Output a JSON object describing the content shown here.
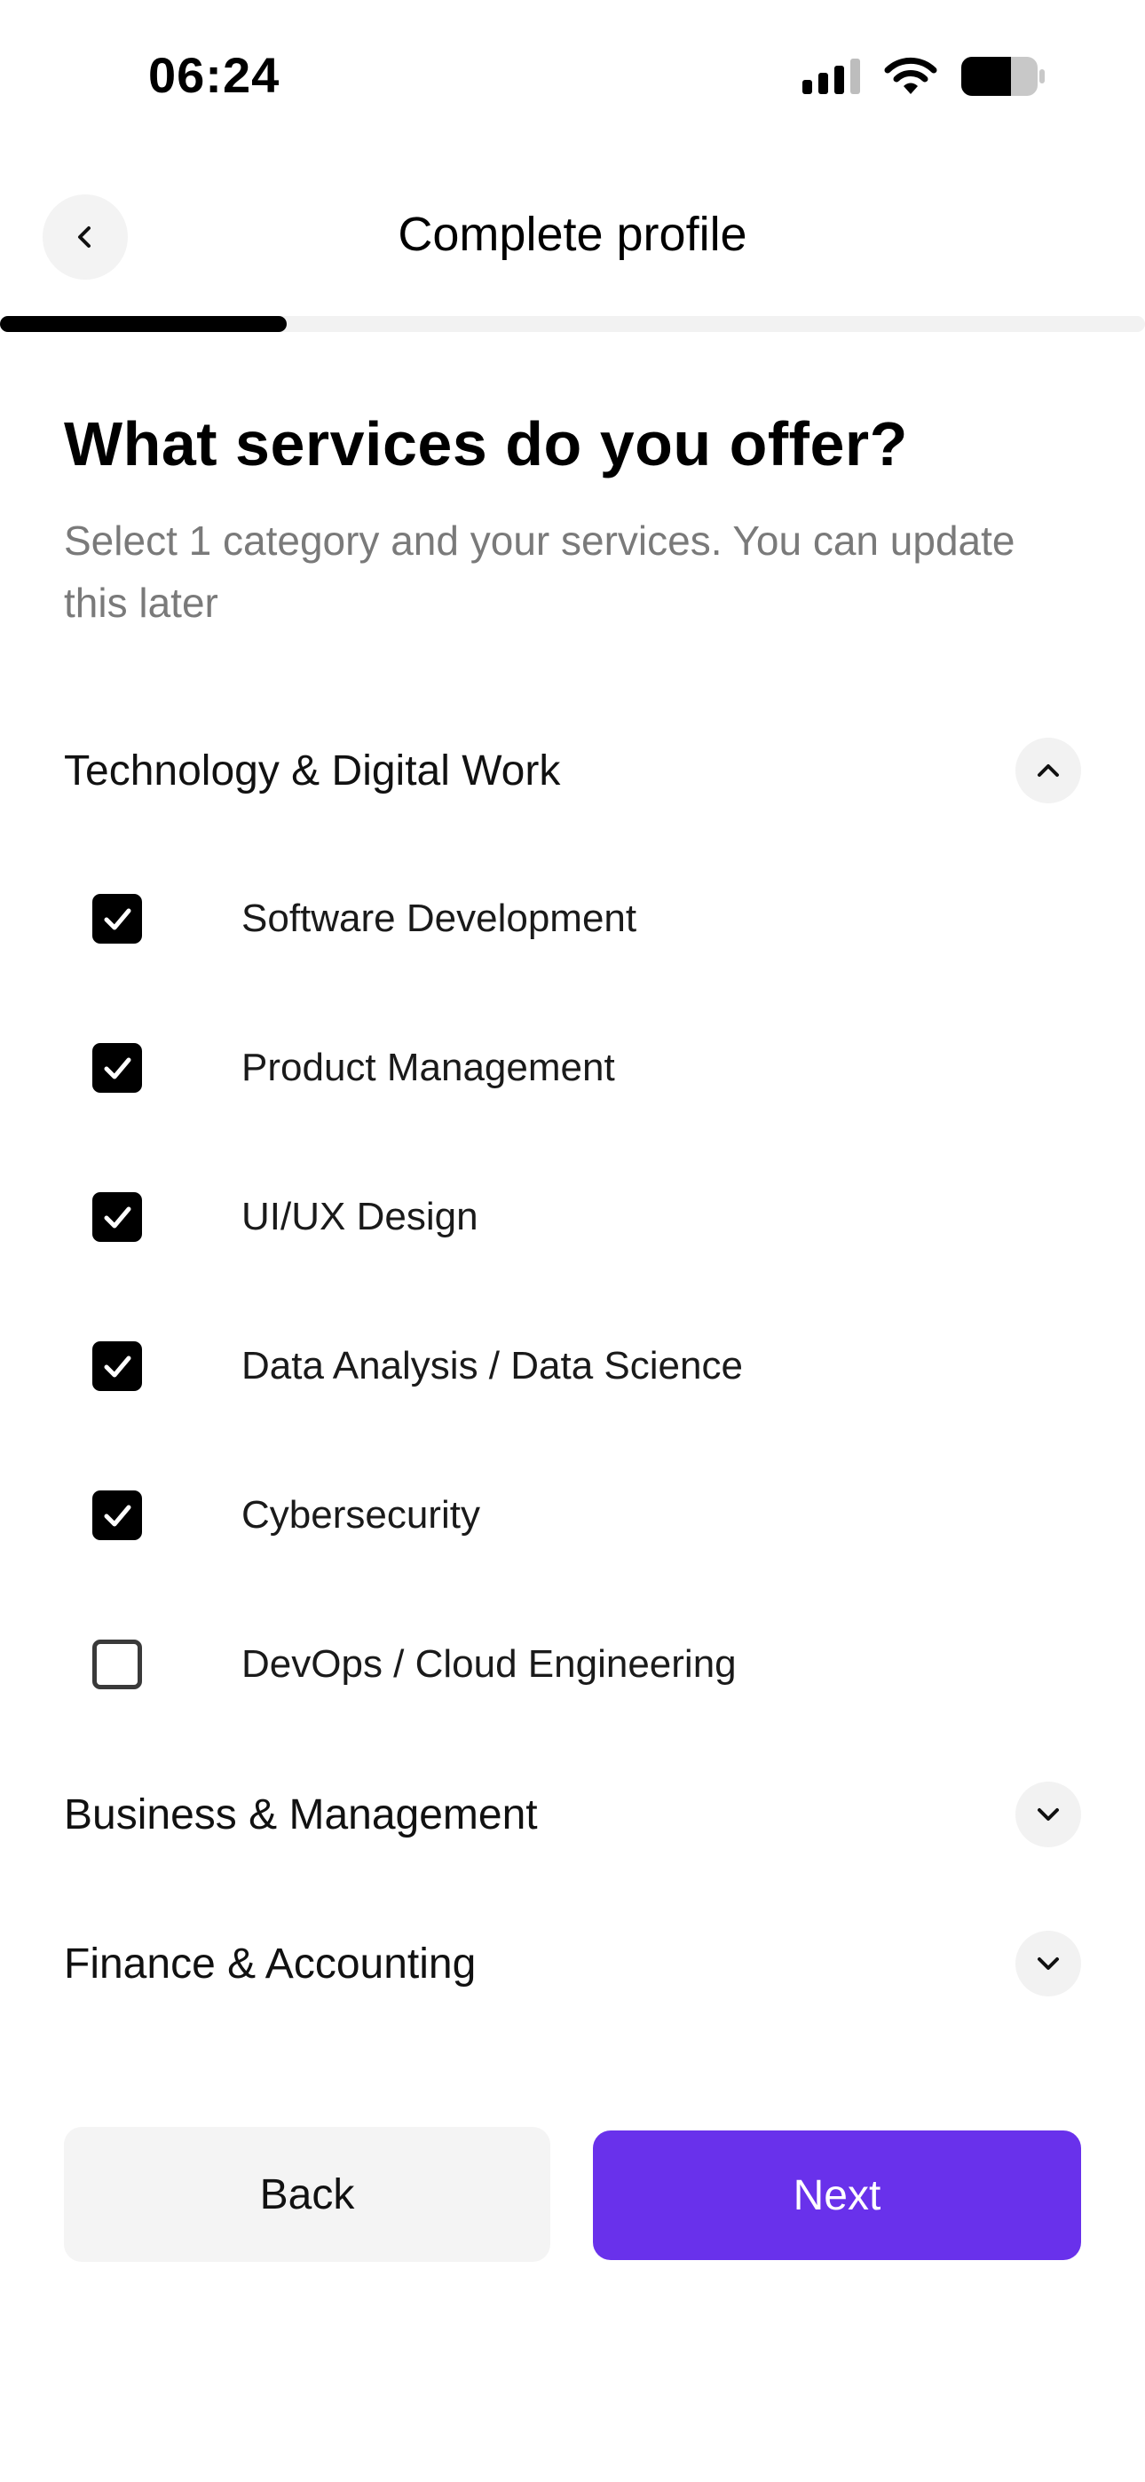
{
  "status_bar": {
    "time": "06:24"
  },
  "header": {
    "title": "Complete profile"
  },
  "progress": {
    "fraction": 0.25
  },
  "question": {
    "title": "What services do you offer?",
    "subtitle": "Select 1 category and your services. You can update this later"
  },
  "categories": [
    {
      "label": "Technology & Digital Work",
      "expanded": true,
      "options": [
        {
          "label": "Software Development",
          "checked": true
        },
        {
          "label": "Product Management",
          "checked": true
        },
        {
          "label": "UI/UX Design",
          "checked": true
        },
        {
          "label": "Data Analysis / Data Science",
          "checked": true
        },
        {
          "label": "Cybersecurity",
          "checked": true
        },
        {
          "label": "DevOps / Cloud Engineering",
          "checked": false
        }
      ]
    },
    {
      "label": "Business & Management",
      "expanded": false
    },
    {
      "label": "Finance & Accounting",
      "expanded": false
    }
  ],
  "buttons": {
    "back": "Back",
    "next": "Next"
  },
  "colors": {
    "accent": "#6931eb",
    "progress": "#000000",
    "muted_text": "#7a7a7a"
  }
}
